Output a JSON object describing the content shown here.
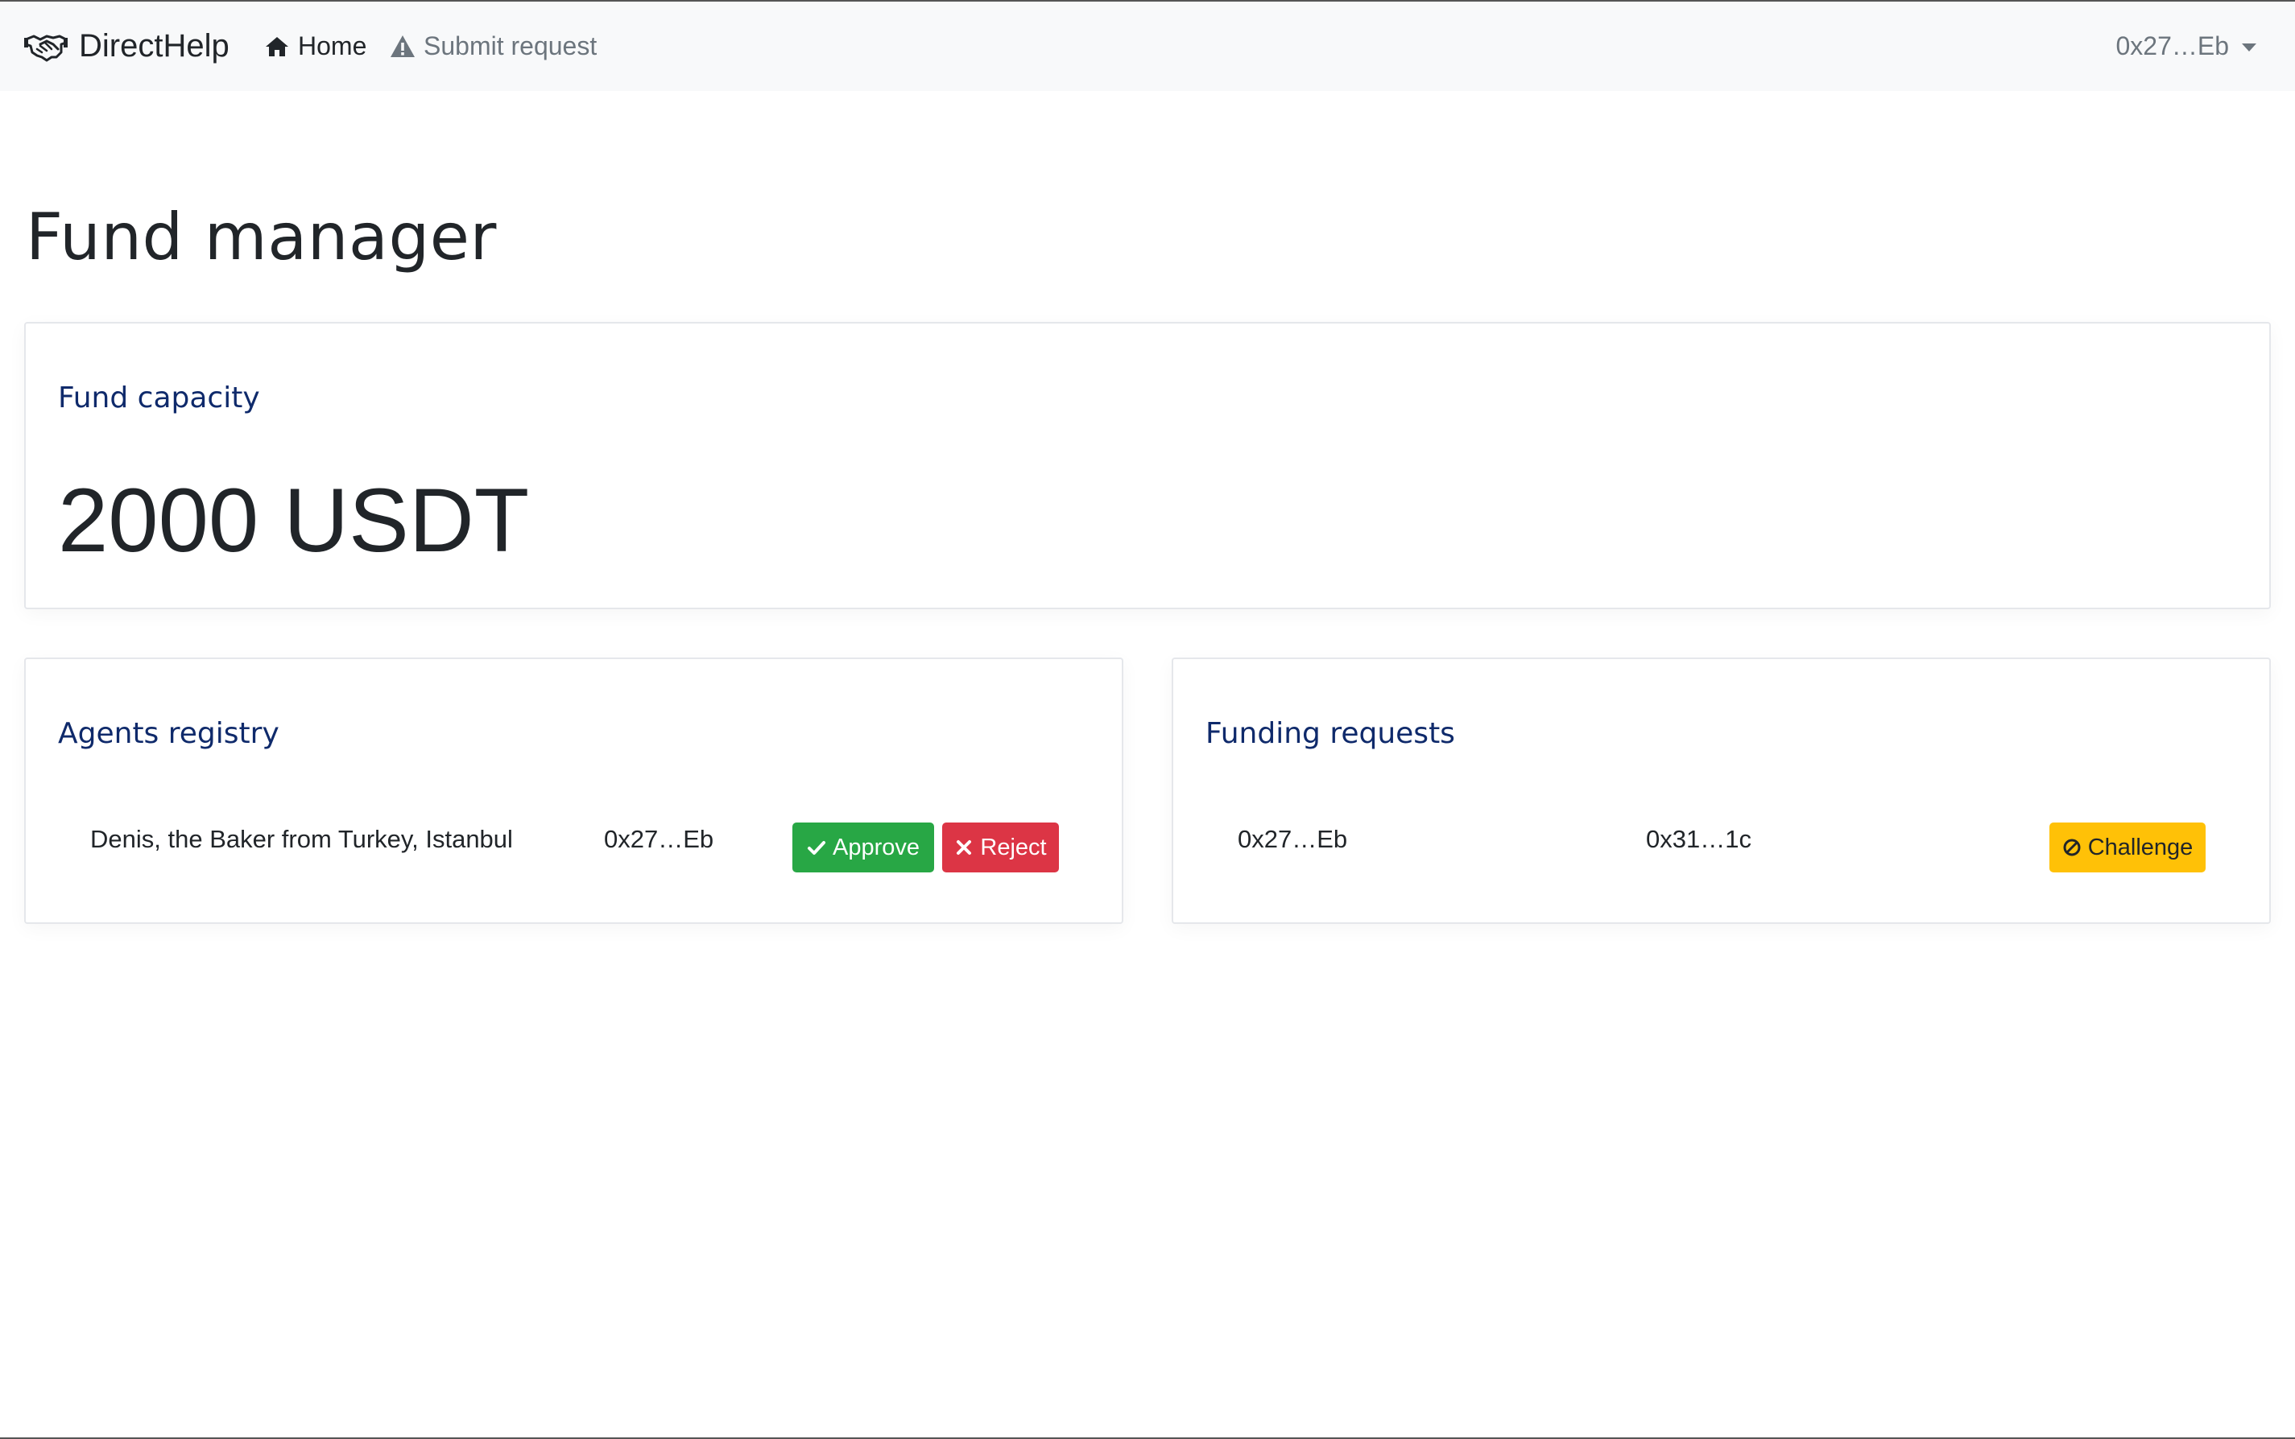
{
  "navbar": {
    "brand": "DirectHelp",
    "brand_icon": "handshake-icon",
    "links": [
      {
        "label": "Home",
        "icon": "home-icon",
        "active": true
      },
      {
        "label": "Submit request",
        "icon": "warning-icon",
        "active": false
      }
    ],
    "account": "0x27…Eb"
  },
  "page": {
    "title": "Fund manager"
  },
  "capacity": {
    "title": "Fund capacity",
    "value": "2000 USDT"
  },
  "agents": {
    "title": "Agents registry",
    "rows": [
      {
        "name": "Denis, the Baker from Turkey, Istanbul",
        "address": "0x27…Eb",
        "approve_label": "Approve",
        "reject_label": "Reject"
      }
    ]
  },
  "funding": {
    "title": "Funding requests",
    "rows": [
      {
        "from": "0x27…Eb",
        "to": "0x31…1c",
        "challenge_label": "Challenge"
      }
    ]
  },
  "colors": {
    "approve": "#28a745",
    "reject": "#dc3545",
    "challenge": "#ffc107",
    "card_title": "#0f2a6b",
    "navbar_bg": "#f8f9fa"
  }
}
